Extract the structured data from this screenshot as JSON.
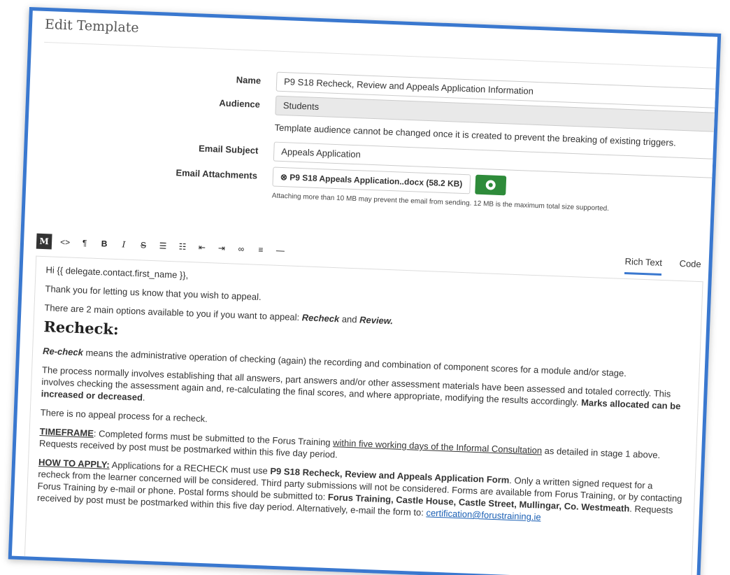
{
  "page": {
    "title": "Edit Template"
  },
  "form": {
    "name_label": "Name",
    "name_value": "P9 S18 Recheck, Review and Appeals Application Information",
    "audience_label": "Audience",
    "audience_value": "Students",
    "audience_help": "Template audience cannot be changed once it is created to prevent the breaking of existing triggers.",
    "subject_label": "Email Subject",
    "subject_value": "Appeals Application",
    "attachments_label": "Email Attachments",
    "attachment_file": "P9 S18 Appeals Application..docx (58.2 KB)",
    "attachment_help": "Attaching more than 10 MB may prevent the email from sending. 12 MB is the maximum total size supported."
  },
  "toolbar": {
    "markdown_btn": "M",
    "code_btn": "<>",
    "paragraph_btn": "¶",
    "bold_btn": "B",
    "italic_btn": "I",
    "strike_btn": "S",
    "tabs": [
      "Rich Text",
      "Code"
    ]
  },
  "body": {
    "greeting": "Hi {{ delegate.contact.first_name }},",
    "thanks": "Thank you for letting us know that you wish to appeal.",
    "options_pre": "There are 2 main options available to you if you want to appeal: ",
    "options_recheck": "Recheck",
    "options_and": " and ",
    "options_review": "Review.",
    "heading": "Recheck:",
    "recheck_term": "Re-check",
    "recheck_def": " means the administrative operation of checking (again) the recording and combination of component scores for a module and/or stage.",
    "process_text": "The process normally involves establishing that all answers, part answers and/or other assessment materials have been assessed and totaled correctly. This involves checking the assessment again and, re-calculating the final scores, and where appropriate, modifying the results accordingly. ",
    "process_bold": "Marks allocated can be increased or decreased",
    "process_end": ".",
    "no_appeal": "There is no appeal process for a recheck.",
    "timeframe_label": "TIMEFRAME",
    "timeframe_text1": ": Completed forms must be submitted to the Forus Training ",
    "timeframe_underline": "within five working days of the Informal Consultation",
    "timeframe_text2": " as detailed in stage 1 above. Requests received by post must be postmarked within this five day period.",
    "howto_label": "HOW TO APPLY:",
    "howto_text1": " Applications for a RECHECK must use ",
    "howto_form": "P9 S18 Recheck, Review and Appeals Application Form",
    "howto_text2": ". Only a written signed request for a recheck from the learner concerned will be considered. Third party submissions will not be considered. Forms are available from Forus Training, or by contacting Forus Training by e-mail or phone. Postal forms should be submitted to: ",
    "howto_address": "Forus Training, Castle House, Castle Street, Mullingar, Co. Westmeath",
    "howto_text3": ". Requests received by post must be postmarked within this five day period. Alternatively, e-mail the form to: ",
    "howto_email": "certification@forustraining.ie"
  }
}
